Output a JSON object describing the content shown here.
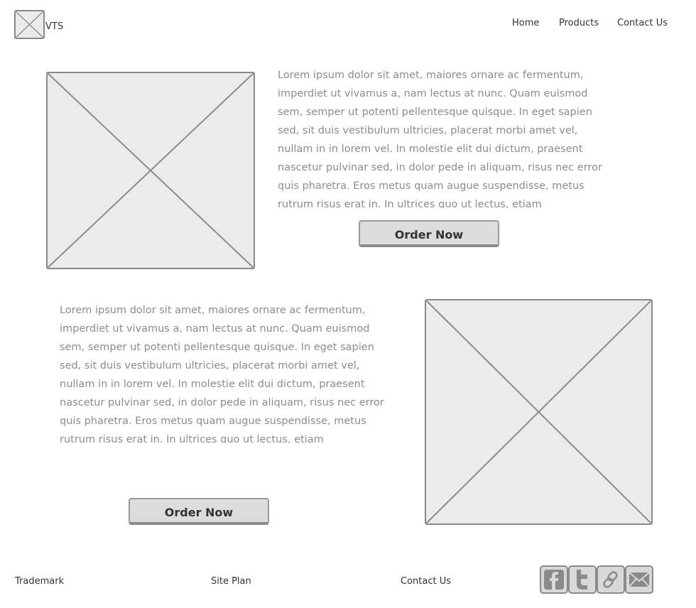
{
  "header": {
    "logo_text": "VTS",
    "nav": [
      "Home",
      "Products",
      "Contact Us"
    ]
  },
  "sections": [
    {
      "text": "Lorem ipsum dolor sit amet, maiores ornare ac fermentum, imperdiet ut vivamus a, nam lectus at nunc. Quam euismod sem, semper ut potenti pellentesque quisque. In eget sapien sed, sit duis vestibulum ultricies, placerat morbi amet vel, nullam in in lorem vel. In molestie elit dui dictum, praesent nascetur pulvinar sed, in dolor pede in aliquam, risus nec error quis pharetra. Eros metus quam augue suspendisse, metus rutrum risus erat in. In ultrices quo ut lectus, etiam",
      "button_label": "Order Now"
    },
    {
      "text": "Lorem ipsum dolor sit amet, maiores ornare ac fermentum, imperdiet ut vivamus a, nam lectus at nunc. Quam euismod sem, semper ut potenti pellentesque quisque. In eget sapien sed, sit duis vestibulum ultricies, placerat morbi amet vel, nullam in in lorem vel. In molestie elit dui dictum, praesent nascetur pulvinar sed, in dolor pede in aliquam, risus nec error quis pharetra. Eros metus quam augue suspendisse, metus rutrum risus erat in. In ultrices quo ut lectus, etiam",
      "button_label": "Order Now"
    }
  ],
  "footer": {
    "links": [
      "Trademark",
      "Site Plan",
      "Contact Us"
    ],
    "social_icons": [
      "facebook-icon",
      "twitter-icon",
      "link-icon",
      "email-icon"
    ]
  }
}
